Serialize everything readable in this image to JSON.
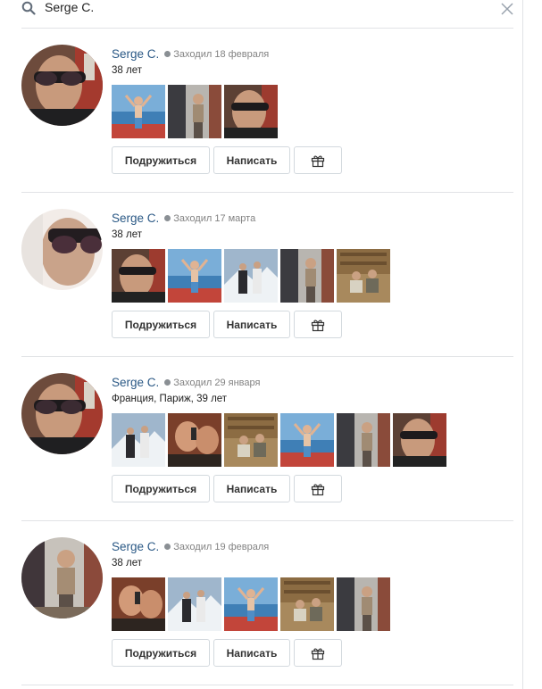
{
  "search": {
    "query": "Serge C.",
    "search_icon": "search-icon",
    "close_icon": "close-icon"
  },
  "colors": {
    "link": "#2a5885",
    "muted": "#828282",
    "divider": "#e1e3e6",
    "button_border": "#d3d9de"
  },
  "buttons": {
    "add_friend": "Подружиться",
    "message": "Написать",
    "gift_icon": "gift-icon"
  },
  "results": [
    {
      "name": "Serge C.",
      "last_seen": "Заходил 18 февраля",
      "info": "38 лет",
      "photo_count": 3,
      "photos": [
        "photo-sea-arms-up",
        "photo-street-standing",
        "photo-selfie-sunglasses"
      ]
    },
    {
      "name": "Serge C.",
      "last_seen": "Заходил 17 марта",
      "info": "38 лет",
      "photo_count": 5,
      "photos": [
        "photo-selfie-sunglasses",
        "photo-sea-arms-up",
        "photo-snow-friends",
        "photo-street-standing",
        "photo-library-sitting"
      ]
    },
    {
      "name": "Serge C.",
      "last_seen": "Заходил 29 января",
      "info": "Франция, Париж, 39 лет",
      "photo_count": 6,
      "photos": [
        "photo-snow-friends",
        "photo-phone-friends",
        "photo-library-sitting",
        "photo-sea-arms-up",
        "photo-street-standing",
        "photo-selfie-sunglasses"
      ]
    },
    {
      "name": "Serge C.",
      "last_seen": "Заходил 19 февраля",
      "info": "38 лет",
      "photo_count": 5,
      "photos": [
        "photo-phone-friends",
        "photo-snow-friends",
        "photo-sea-arms-up",
        "photo-library-sitting",
        "photo-street-standing"
      ]
    }
  ]
}
